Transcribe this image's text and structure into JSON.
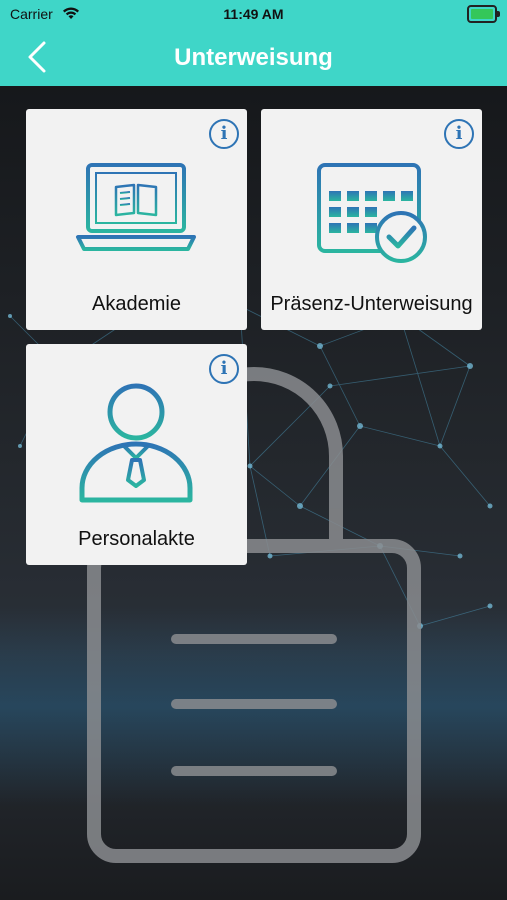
{
  "status_bar": {
    "carrier": "Carrier",
    "time": "11:49 AM"
  },
  "nav": {
    "title": "Unterweisung",
    "back_icon": "chevron-left-icon"
  },
  "tiles": [
    {
      "label": "Akademie",
      "icon": "laptop-book-icon",
      "info_icon": "info-icon"
    },
    {
      "label": "Präsenz-Unterweisung",
      "icon": "calendar-check-icon",
      "info_icon": "info-icon"
    },
    {
      "label": "Personalakte",
      "icon": "person-tie-icon",
      "info_icon": "info-icon"
    }
  ],
  "colors": {
    "accent": "#3fd6c8",
    "icon_blue": "#2e74b5",
    "icon_teal": "#2bb5a0",
    "tile_bg": "#f2f2f2"
  }
}
